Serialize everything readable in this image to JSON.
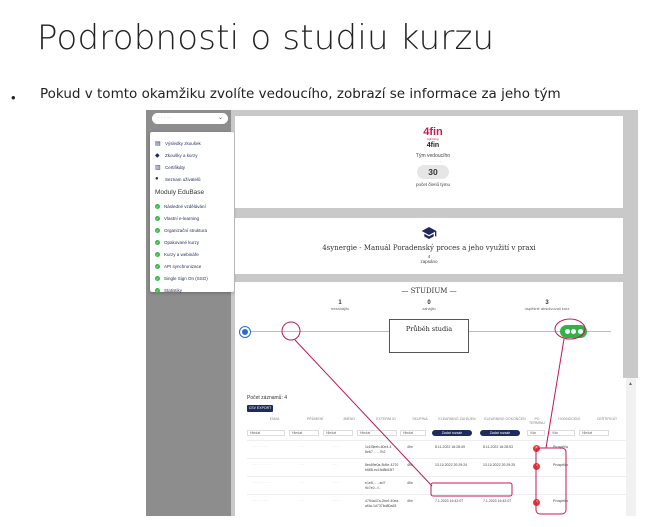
{
  "slide": {
    "title": "Podrobnosti o studiu kurzu",
    "bullet": "Pokud v tomto okamžiku zvolíte vedoucího, zobrazí se informace za jeho tým"
  },
  "sidebar": {
    "user_select": "· · · · ·",
    "items": [
      {
        "label": "Výsledky zkoušek",
        "icon": "document-icon"
      },
      {
        "label": "Zkoušky a kurzy",
        "icon": "graduation-cap-icon"
      },
      {
        "label": "Certifikáty",
        "icon": "certificate-icon"
      },
      {
        "label": "Seznam uživatelů",
        "icon": "user-icon"
      }
    ],
    "modules_heading": "Moduly EduBase",
    "modules": [
      "Následné vzdělávání",
      "Vlastní e-learning",
      "Organizační struktura",
      "Opakované kurzy",
      "Kurzy a webináře",
      "API synchronizace",
      "Single Sign On (SSO)",
      "Statistiky"
    ]
  },
  "team": {
    "logo": "4fin",
    "logo_sub": "lightning",
    "brand": "4fin",
    "leader_label": "Tým vedoucího",
    "leader_name": "· · · · · · ·",
    "count": "30",
    "count_label": "počet členů týmu"
  },
  "course": {
    "title": "4synergie - Manuál Poradenský proces a jeho využití v praxi",
    "count": "4",
    "unit": "zapsáno"
  },
  "studium": {
    "heading": "— STUDIUM —",
    "stats": [
      {
        "n": "1",
        "label": "nezahájilo"
      },
      {
        "n": "0",
        "label": "zahájilo"
      },
      {
        "n": "3",
        "label": "úspěšně absolvovali kurz"
      }
    ],
    "progress_label": "Průběh studia"
  },
  "table": {
    "records": "Počet záznamů: 4",
    "csv": "CSV EXPORT",
    "headers": [
      "EMAIL",
      "PŘÍJMENÍ",
      "JMÉNO",
      "EXTERNÍ ID",
      "SKUPINA",
      "ELEARNING ZAHÁJEN",
      "ELEARNING DOKONČEN",
      "PO TERMÍNU",
      "HODNOCENÍ",
      "CERTIFIKÁT"
    ],
    "filters": {
      "f1": "Hledat",
      "f2": "Hledat",
      "f3": "Hledat",
      "f4": "Hledat",
      "f5": "Hledat",
      "btn1": "Zadat rozsah",
      "btn2": "Zadat rozsah",
      "sel1": "Vše",
      "sel2": "Vše",
      "f6": "Hledat"
    },
    "rows": [
      {
        "email": "· · · · · · ·",
        "surname": "· · ·",
        "name": "· · · ·",
        "ext": "1c1f3eeb-60e4-4",
        "ext2": "8e67... ...7b2",
        "group": "4fin",
        "start": "8.11.2022 16:28:49",
        "end": "8.11.2022 16:28:53",
        "result": "Prospěl/a"
      },
      {
        "email": "· · · · · · · · ·",
        "surname": "· · ·",
        "name": "· · ·",
        "ext": "8ec89e0a-5b5e-4270",
        "ext2": "b688-ec15d8b63f7",
        "group": "4fin",
        "start": "13.10.2022 20:29:24",
        "end": "13.10.2022 20:29:25",
        "result": "Prospěl/a"
      },
      {
        "email": "· · · · · · · · ·",
        "surname": "· · ·",
        "name": "· · · ·",
        "ext": "e1e6... ...ed7",
        "ext2": "9c7e0...f...",
        "group": "4fin",
        "start": "",
        "end": "",
        "result": ""
      },
      {
        "email": "· · · · · · ·",
        "surname": "· · ·",
        "name": "· · · ·",
        "ext": "4794a47a-2bc9-40ea",
        "ext2": "af4a-1d7376d80a63",
        "group": "4fin",
        "start": "7.1.2023 16:42:07",
        "end": "7.1.2023 16:42:07",
        "result": "Prospěl/a"
      }
    ]
  },
  "colors": {
    "navy": "#1f2b5c",
    "green": "#2fb346",
    "red": "#e53935",
    "annotation": "#c0185a"
  }
}
